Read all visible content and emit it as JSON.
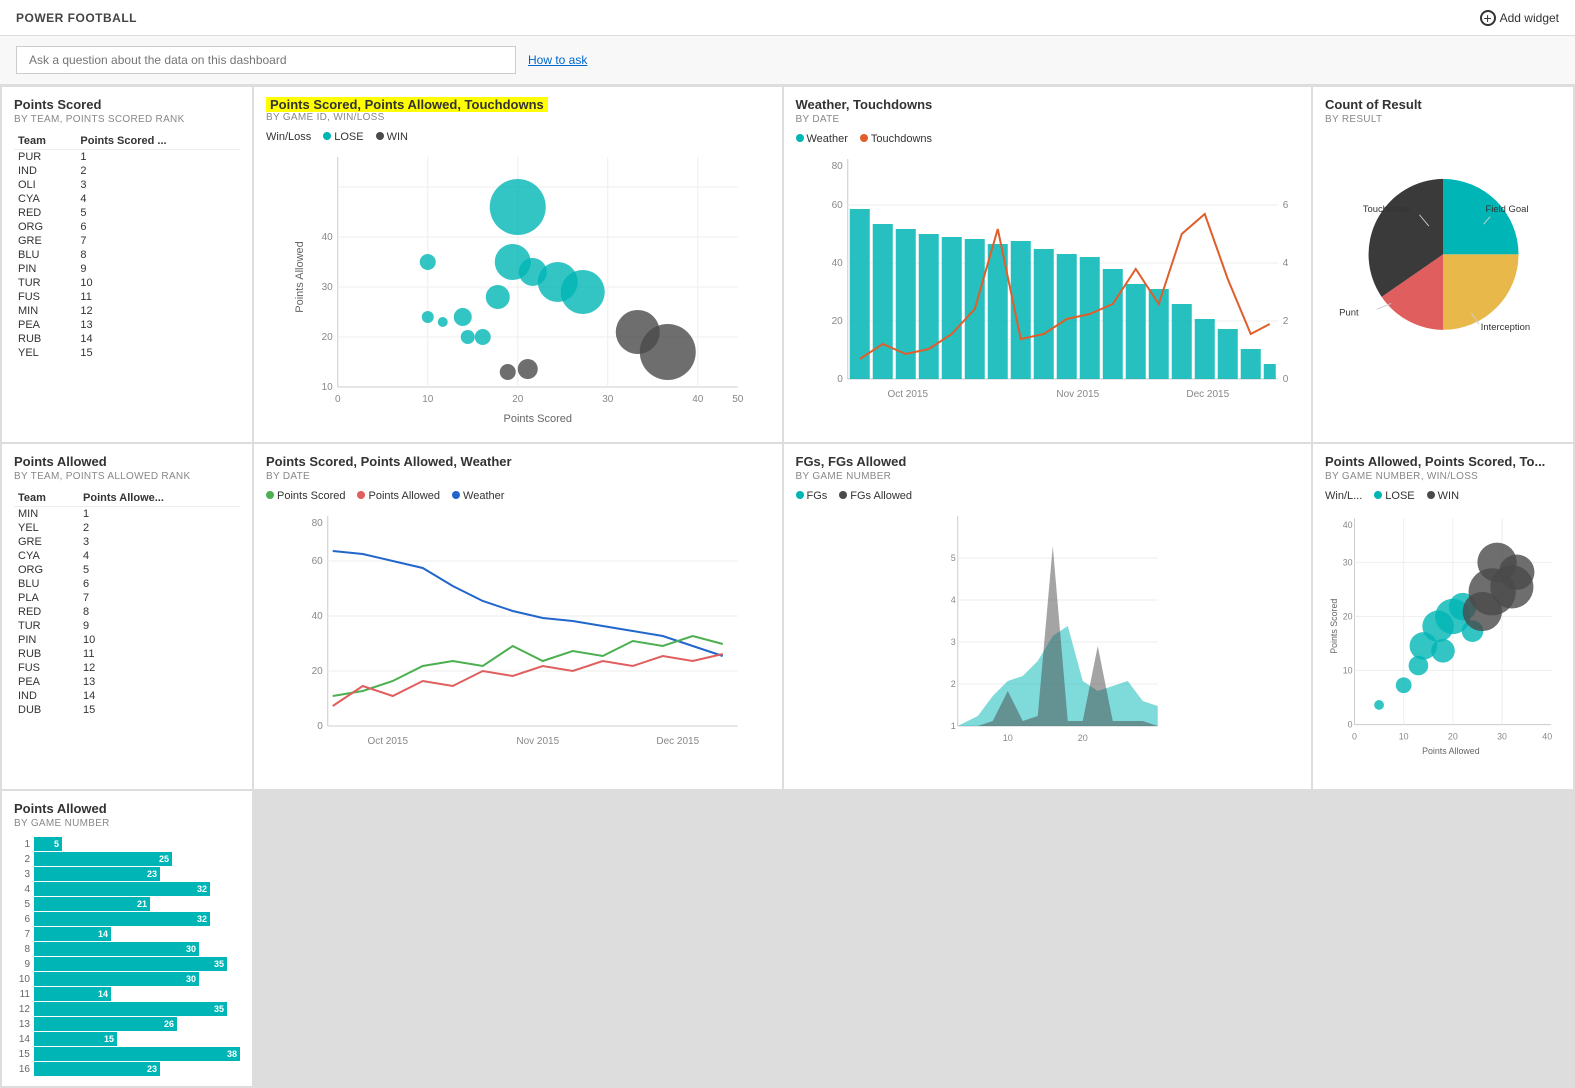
{
  "header": {
    "title": "POWER FOOTBALL",
    "add_widget_label": "Add widget"
  },
  "search": {
    "placeholder": "Ask a question about the data on this dashboard",
    "how_to_ask": "How to ask"
  },
  "widgets": {
    "points_scored": {
      "title": "Points Scored",
      "subtitle": "BY TEAM, POINTS SCORED RANK",
      "columns": [
        "Team",
        "Points Scored ..."
      ],
      "rows": [
        [
          "PUR",
          "1"
        ],
        [
          "IND",
          "2"
        ],
        [
          "OLI",
          "3"
        ],
        [
          "CYA",
          "4"
        ],
        [
          "RED",
          "5"
        ],
        [
          "ORG",
          "6"
        ],
        [
          "GRE",
          "7"
        ],
        [
          "BLU",
          "8"
        ],
        [
          "PIN",
          "9"
        ],
        [
          "TUR",
          "10"
        ],
        [
          "FUS",
          "11"
        ],
        [
          "MIN",
          "12"
        ],
        [
          "PEA",
          "13"
        ],
        [
          "RUB",
          "14"
        ],
        [
          "YEL",
          "15"
        ]
      ]
    },
    "scatter_wl": {
      "title": "Points Scored, Points Allowed, Touchdowns",
      "subtitle": "BY GAME ID, WIN/LOSS",
      "legend": [
        "LOSE",
        "WIN"
      ]
    },
    "weather_touchdowns": {
      "title": "Weather, Touchdowns",
      "subtitle": "BY DATE",
      "legend": [
        "Weather",
        "Touchdowns"
      ]
    },
    "count_result": {
      "title": "Count of Result",
      "subtitle": "BY RESULT",
      "segments": [
        "Touchdown",
        "Field Goal",
        "Punt",
        "Interception"
      ]
    },
    "points_allowed": {
      "title": "Points Allowed",
      "subtitle": "BY TEAM, POINTS ALLOWED RANK",
      "columns": [
        "Team",
        "Points Allowe..."
      ],
      "rows": [
        [
          "MIN",
          "1"
        ],
        [
          "YEL",
          "2"
        ],
        [
          "GRE",
          "3"
        ],
        [
          "CYA",
          "4"
        ],
        [
          "ORG",
          "5"
        ],
        [
          "BLU",
          "6"
        ],
        [
          "PLA",
          "7"
        ],
        [
          "RED",
          "8"
        ],
        [
          "TUR",
          "9"
        ],
        [
          "PIN",
          "10"
        ],
        [
          "RUB",
          "11"
        ],
        [
          "FUS",
          "12"
        ],
        [
          "PEA",
          "13"
        ],
        [
          "IND",
          "14"
        ],
        [
          "DUB",
          "15"
        ]
      ]
    },
    "line_chart": {
      "title": "Points Scored, Points Allowed, Weather",
      "subtitle": "BY DATE",
      "legend": [
        "Points Scored",
        "Points Allowed",
        "Weather"
      ]
    },
    "fgs_allowed": {
      "title": "FGs, FGs Allowed",
      "subtitle": "BY GAME NUMBER",
      "legend": [
        "FGs",
        "FGs Allowed"
      ]
    },
    "scatter2": {
      "title": "Points Allowed, Points Scored, To...",
      "subtitle": "BY GAME NUMBER, WIN/LOSS",
      "legend": [
        "LOSE",
        "WIN"
      ]
    },
    "bar_chart": {
      "title": "Points Allowed",
      "subtitle": "BY GAME NUMBER",
      "bars": [
        {
          "label": "1",
          "value": 5
        },
        {
          "label": "2",
          "value": 25
        },
        {
          "label": "3",
          "value": 23
        },
        {
          "label": "4",
          "value": 32
        },
        {
          "label": "5",
          "value": 21
        },
        {
          "label": "6",
          "value": 32
        },
        {
          "label": "7",
          "value": 14
        },
        {
          "label": "8",
          "value": 30
        },
        {
          "label": "9",
          "value": 35
        },
        {
          "label": "10",
          "value": 30
        },
        {
          "label": "11",
          "value": 14
        },
        {
          "label": "12",
          "value": 35
        },
        {
          "label": "13",
          "value": 26
        },
        {
          "label": "14",
          "value": 15
        },
        {
          "label": "15",
          "value": 38
        },
        {
          "label": "16",
          "value": 23
        }
      ]
    }
  },
  "colors": {
    "teal": "#00b5b5",
    "orange": "#e05e2a",
    "yellow": "#ffff00",
    "highlight_yellow": "#ffff00",
    "dark_gray": "#4a4a4a",
    "pie_teal": "#00b5b5",
    "pie_yellow": "#e8b84b",
    "pie_red": "#e05e5e",
    "pie_dark": "#3a3a3a"
  }
}
